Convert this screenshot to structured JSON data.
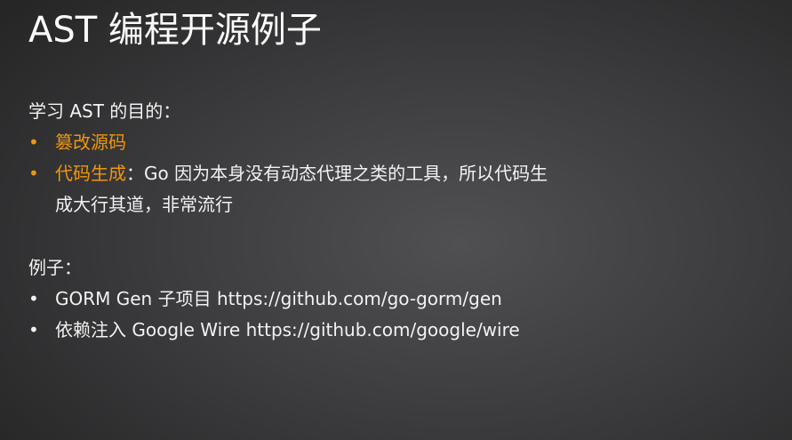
{
  "title": "AST 编程开源例子",
  "purpose": {
    "heading": "学习 AST 的目的：",
    "items": [
      {
        "highlight": "篡改源码",
        "text": ""
      },
      {
        "highlight": "代码生成",
        "text": "：Go 因为本身没有动态代理之类的工具，所以代码生",
        "continuation": "成大行其道，非常流行"
      }
    ]
  },
  "examples": {
    "heading": "例子：",
    "items": [
      "GORM Gen 子项目 https://github.com/go-gorm/gen",
      "依赖注入 Google Wire https://github.com/google/wire"
    ]
  },
  "bullet": "•",
  "colors": {
    "accent": "#f0960e"
  }
}
